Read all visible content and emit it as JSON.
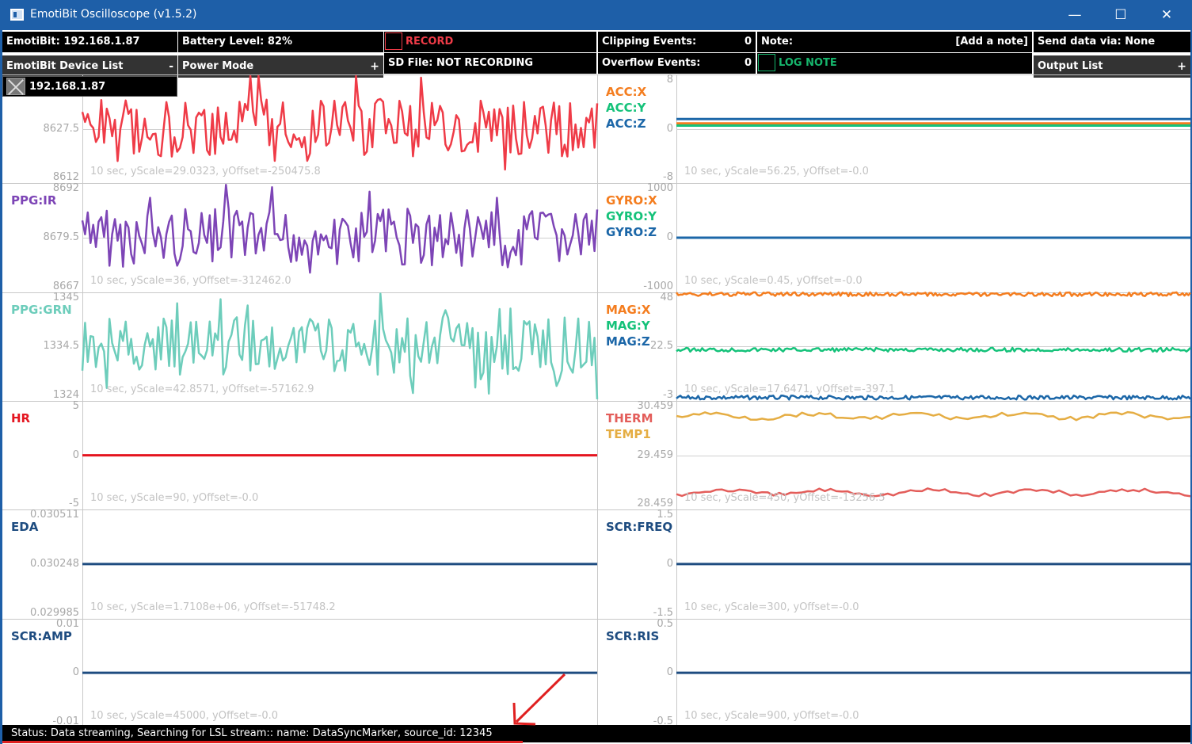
{
  "window": {
    "title": "EmotiBit Oscilloscope (v1.5.2)",
    "minimize_glyph": "—",
    "maximize_glyph": "☐",
    "close_glyph": "✕",
    "icon": "app-window-icon"
  },
  "header": {
    "device": "EmotiBit: 192.168.1.87",
    "battery": "Battery Level: 82%",
    "record_label": "RECORD",
    "sd_file": "SD File: NOT RECORDING",
    "clipping_label": "Clipping Events:",
    "clipping_value": "0",
    "overflow_label": "Overflow Events:",
    "overflow_value": "0",
    "note_label": "Note:",
    "note_placeholder": "[Add a note]",
    "log_note_label": "LOG NOTE",
    "send_data": "Send data via: None",
    "device_list_label": "EmotiBit Device List",
    "device_list_toggle": "-",
    "power_mode_label": "Power Mode",
    "power_mode_toggle": "+",
    "output_list_label": "Output List",
    "output_list_toggle": "+"
  },
  "device_list": {
    "items": [
      {
        "ip": "192.168.1.87",
        "checked": false
      }
    ]
  },
  "colors": {
    "titlebar": "#1e5fa8",
    "ppg_red": "#ef3b47",
    "ppg_ir": "#7d45b6",
    "ppg_grn": "#6dcdbb",
    "x_orange": "#f47d1f",
    "y_green": "#15c27a",
    "z_blue": "#1c67a8",
    "hr_red": "#e4151f",
    "therm": "#e35d5a",
    "temp1": "#e5ad43",
    "eda_navy": "#1e4c80",
    "record_red": "#ef3b47",
    "lognote_green": "#16b56c"
  },
  "panels": [
    {
      "id": "ppg-red",
      "side": "left",
      "row": 0,
      "labels": [],
      "yticks": [
        "",
        "8627.5",
        "8612"
      ],
      "info": "10 sec, yScale=29.0323, yOffset=-250475.8",
      "series": [
        {
          "color": "#ef3b47",
          "level": 0.5,
          "noise": "spiky",
          "seed": 3
        }
      ]
    },
    {
      "id": "ppg-ir",
      "side": "left",
      "row": 1,
      "labels": [
        {
          "text": "PPG:IR",
          "color": "#7d45b6"
        }
      ],
      "yticks": [
        "8692",
        "8679.5",
        "8667"
      ],
      "info": "10 sec, yScale=36, yOffset=-312462.0",
      "series": [
        {
          "color": "#7d45b6",
          "level": 0.5,
          "noise": "spiky",
          "seed": 7
        }
      ]
    },
    {
      "id": "ppg-grn",
      "side": "left",
      "row": 2,
      "labels": [
        {
          "text": "PPG:GRN",
          "color": "#6dcdbb"
        }
      ],
      "yticks": [
        "1345",
        "1334.5",
        "1324"
      ],
      "info": "10 sec, yScale=42.8571, yOffset=-57162.9",
      "series": [
        {
          "color": "#6dcdbb",
          "level": 0.5,
          "noise": "spiky",
          "seed": 11
        }
      ]
    },
    {
      "id": "hr",
      "side": "left",
      "row": 3,
      "labels": [
        {
          "text": "HR",
          "color": "#e4151f"
        }
      ],
      "yticks": [
        "5",
        "0",
        "-5"
      ],
      "info": "10 sec, yScale=90, yOffset=-0.0",
      "series": [
        {
          "color": "#e4151f",
          "level": 0.5,
          "noise": "flat",
          "seed": 1
        }
      ]
    },
    {
      "id": "eda",
      "side": "left",
      "row": 4,
      "labels": [
        {
          "text": "EDA",
          "color": "#1e4c80"
        }
      ],
      "yticks": [
        "0.030511",
        "0.030248",
        "0.029985"
      ],
      "info": "10 sec, yScale=1.7108e+06, yOffset=-51748.2",
      "series": [
        {
          "color": "#1e4c80",
          "level": 0.5,
          "noise": "flat",
          "seed": 2
        }
      ]
    },
    {
      "id": "scr-amp",
      "side": "left",
      "row": 5,
      "labels": [
        {
          "text": "SCR:AMP",
          "color": "#1e4c80"
        }
      ],
      "yticks": [
        "0.01",
        "0",
        "-0.01"
      ],
      "info": "10 sec, yScale=45000, yOffset=-0.0",
      "series": [
        {
          "color": "#1e4c80",
          "level": 0.5,
          "noise": "flat",
          "seed": 2
        }
      ]
    },
    {
      "id": "acc",
      "side": "right",
      "row": 0,
      "labels": [
        {
          "text": "ACC:X",
          "color": "#f47d1f"
        },
        {
          "text": "ACC:Y",
          "color": "#15c27a"
        },
        {
          "text": "ACC:Z",
          "color": "#1c67a8"
        }
      ],
      "yticks": [
        "8",
        "0",
        "-8"
      ],
      "info": "10 sec, yScale=56.25, yOffset=-0.0",
      "series": [
        {
          "color": "#f47d1f",
          "level": 0.45,
          "noise": "flat",
          "seed": 1
        },
        {
          "color": "#15c27a",
          "level": 0.47,
          "noise": "flat",
          "seed": 1
        },
        {
          "color": "#1c67a8",
          "level": 0.41,
          "noise": "flat",
          "seed": 1
        }
      ]
    },
    {
      "id": "gyro",
      "side": "right",
      "row": 1,
      "labels": [
        {
          "text": "GYRO:X",
          "color": "#f47d1f"
        },
        {
          "text": "GYRO:Y",
          "color": "#15c27a"
        },
        {
          "text": "GYRO:Z",
          "color": "#1c67a8"
        }
      ],
      "yticks": [
        "1000",
        "0",
        "-1000"
      ],
      "info": "10 sec, yScale=0.45, yOffset=-0.0",
      "series": [
        {
          "color": "#f47d1f",
          "level": 0.5,
          "noise": "flat",
          "seed": 1
        },
        {
          "color": "#15c27a",
          "level": 0.5,
          "noise": "flat",
          "seed": 1
        },
        {
          "color": "#1c67a8",
          "level": 0.5,
          "noise": "flat",
          "seed": 1
        }
      ]
    },
    {
      "id": "mag",
      "side": "right",
      "row": 2,
      "labels": [
        {
          "text": "MAG:X",
          "color": "#f47d1f"
        },
        {
          "text": "MAG:Y",
          "color": "#15c27a"
        },
        {
          "text": "MAG:Z",
          "color": "#1c67a8"
        }
      ],
      "yticks": [
        "48",
        "22.5",
        "-3"
      ],
      "info": "10 sec, yScale=17.6471, yOffset=-397.1",
      "series": [
        {
          "color": "#f47d1f",
          "level": 0.02,
          "noise": "small",
          "seed": 4
        },
        {
          "color": "#15c27a",
          "level": 0.53,
          "noise": "small",
          "seed": 5
        },
        {
          "color": "#1c67a8",
          "level": 0.97,
          "noise": "small",
          "seed": 6
        }
      ]
    },
    {
      "id": "therm",
      "side": "right",
      "row": 3,
      "labels": [
        {
          "text": "THERM",
          "color": "#e35d5a"
        },
        {
          "text": "TEMP1",
          "color": "#e5ad43"
        }
      ],
      "yticks": [
        "30.459",
        "29.459",
        "28.459"
      ],
      "info": "10 sec, yScale=450, yOffset=-13256.5",
      "series": [
        {
          "color": "#e35d5a",
          "level": 0.84,
          "noise": "wave",
          "seed": 8
        },
        {
          "color": "#e5ad43",
          "level": 0.14,
          "noise": "wave",
          "seed": 9
        }
      ]
    },
    {
      "id": "scr-freq",
      "side": "right",
      "row": 4,
      "labels": [
        {
          "text": "SCR:FREQ",
          "color": "#1e4c80"
        }
      ],
      "yticks": [
        "1.5",
        "0",
        "-1.5"
      ],
      "info": "10 sec, yScale=300, yOffset=-0.0",
      "series": [
        {
          "color": "#1e4c80",
          "level": 0.5,
          "noise": "flat",
          "seed": 1
        }
      ]
    },
    {
      "id": "scr-ris",
      "side": "right",
      "row": 5,
      "labels": [
        {
          "text": "SCR:RIS",
          "color": "#1e4c80"
        }
      ],
      "yticks": [
        "0.5",
        "0",
        "-0.5"
      ],
      "info": "10 sec, yScale=900, yOffset=-0.0",
      "series": [
        {
          "color": "#1e4c80",
          "level": 0.5,
          "noise": "flat",
          "seed": 1
        }
      ]
    }
  ],
  "status": "Status: Data streaming, Searching for LSL stream:: name: DataSyncMarker, source_id: 12345"
}
